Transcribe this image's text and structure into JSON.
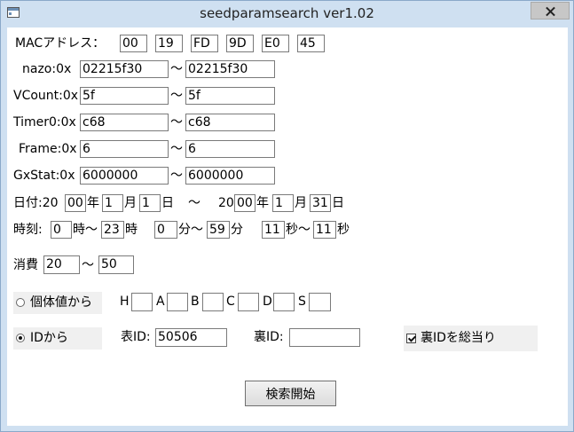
{
  "window": {
    "title": "seedparamsearch ver1.02"
  },
  "mac": {
    "label": "MACアドレス：",
    "octets": [
      "00",
      "19",
      "FD",
      "9D",
      "E0",
      "45"
    ]
  },
  "nazo": {
    "label": "nazo:0x",
    "from": "02215f30",
    "to": "02215f30"
  },
  "vcount": {
    "label": "VCount:0x",
    "from": "5f",
    "to": "5f"
  },
  "timer0": {
    "label": "Timer0:0x",
    "from": "c68",
    "to": "c68"
  },
  "frame": {
    "label": "Frame:0x",
    "from": "6",
    "to": "6"
  },
  "gxstat": {
    "label": "GxStat:0x",
    "from": "6000000",
    "to": "6000000"
  },
  "tilde": "～",
  "date": {
    "label": "日付:20",
    "from": {
      "year": "00",
      "month": "1",
      "day": "1"
    },
    "to": {
      "year_prefix": "20",
      "year": "00",
      "month": "1",
      "day": "31"
    },
    "year_unit": "年",
    "month_unit": "月",
    "day_unit": "日"
  },
  "time": {
    "label": "時刻:",
    "hour_from": "0",
    "hour_to": "23",
    "hour_unit": "時",
    "hour_sep": "時～",
    "minute_from": "0",
    "minute_to": "59",
    "minute_sep": "分～",
    "minute_unit": "分",
    "second_from": "11",
    "second_to": "11",
    "second_sep": "秒～",
    "second_unit": "秒"
  },
  "consumption": {
    "label": "消費",
    "from": "20",
    "to": "50"
  },
  "mode_iv": {
    "label": "個体値から",
    "selected": false
  },
  "iv": {
    "h_label": "H",
    "a_label": "A",
    "b_label": "B",
    "c_label": "C",
    "d_label": "D",
    "s_label": "S",
    "h": "",
    "a": "",
    "b": "",
    "c": "",
    "d": "",
    "s": ""
  },
  "mode_id": {
    "label": "IDから",
    "selected": true
  },
  "ids": {
    "tid_label": "表ID:",
    "tid": "50506",
    "sid_label": "裏ID:",
    "sid": ""
  },
  "brute_sid": {
    "label": "裏IDを総当り",
    "checked": true
  },
  "search_button": {
    "label": "検索開始"
  }
}
